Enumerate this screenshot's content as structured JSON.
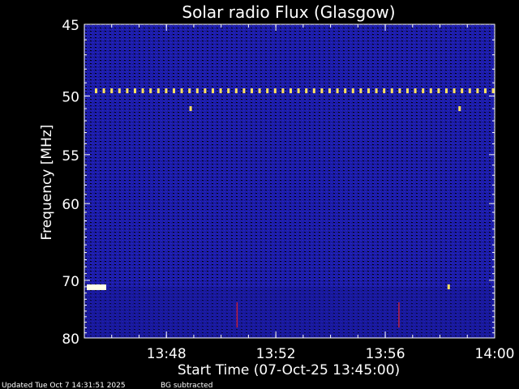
{
  "chart_data": {
    "type": "heatmap",
    "title": "Solar radio Flux (Glasgow)",
    "xlabel": "Start Time (07-Oct-25 13:45:00)",
    "ylabel": "Frequency [MHz]",
    "x_range": [
      "13:45:00",
      "14:00:00"
    ],
    "x_ticks": [
      "13:48",
      "13:52",
      "13:56",
      "14:00"
    ],
    "y_range": [
      45,
      80
    ],
    "y_ticks": [
      "45",
      "50",
      "55",
      "60",
      "70",
      "80"
    ],
    "y_scale": "reciprocal",
    "colormap": "dark blue (low) to red/yellow/white (high)",
    "features": {
      "dashed_line_frequency_mhz": 49.6,
      "bright_segment_frequency_mhz": 71.0,
      "bright_dots": [
        {
          "time": "13:48:54",
          "frequency_mhz": 51.0
        },
        {
          "time": "13:58:44",
          "frequency_mhz": 51.0
        },
        {
          "time": "13:58:20",
          "frequency_mhz": 71.0
        }
      ],
      "red_vertical_streaks": [
        "13:50:35",
        "13:56:30"
      ]
    }
  },
  "colors": {
    "background": "#000000",
    "field": "#1b1ba6",
    "text": "#ffffff",
    "burst_yellow": "#ffe060",
    "burst_white": "#ffffe8",
    "streak_red": "#c02040"
  },
  "footer": {
    "updated": "Updated Tue Oct  7 14:31:51 2025",
    "mode": "BG subtracted"
  }
}
